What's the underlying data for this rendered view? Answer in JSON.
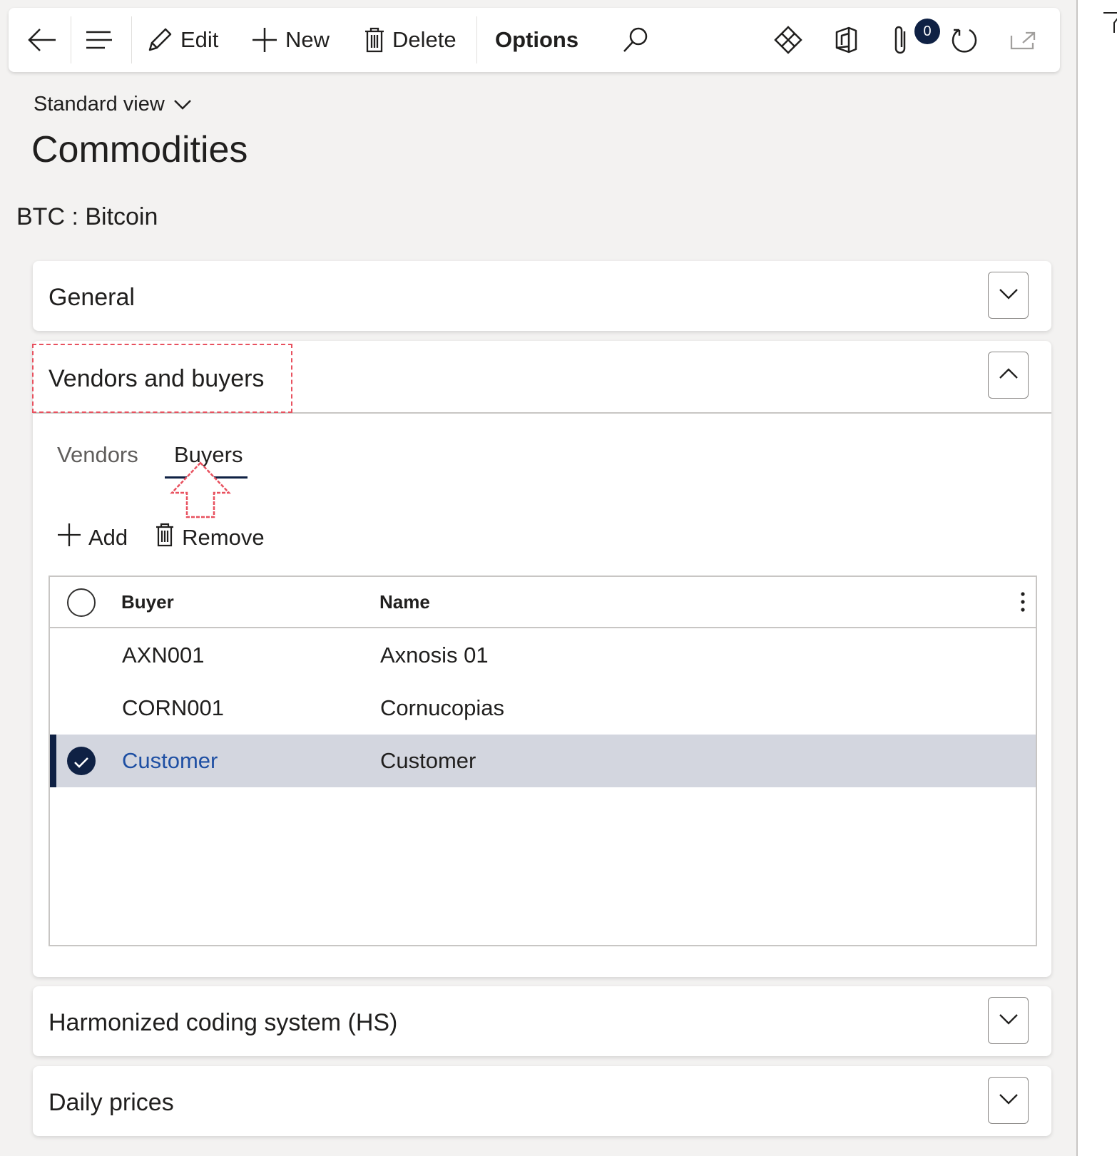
{
  "toolbar": {
    "edit_label": "Edit",
    "new_label": "New",
    "delete_label": "Delete",
    "options_label": "Options",
    "attachments_count": "0"
  },
  "view": {
    "label": "Standard view"
  },
  "page": {
    "title": "Commodities",
    "record": "BTC : Bitcoin"
  },
  "sections": {
    "general": "General",
    "vendors_buyers": "Vendors and buyers",
    "hs": "Harmonized coding system (HS)",
    "daily_prices": "Daily prices"
  },
  "tabs": {
    "vendors": "Vendors",
    "buyers": "Buyers"
  },
  "actions": {
    "add": "Add",
    "remove": "Remove"
  },
  "grid": {
    "columns": {
      "buyer": "Buyer",
      "name": "Name"
    },
    "rows": [
      {
        "buyer": "AXN001",
        "name": "Axnosis 01"
      },
      {
        "buyer": "CORN001",
        "name": "Cornucopias"
      },
      {
        "buyer": "Customer",
        "name": "Customer"
      }
    ]
  },
  "colors": {
    "accent": "#0f2144",
    "link": "#1e4fa3",
    "selected_row": "#d3d6df",
    "annotation": "#e8515f"
  }
}
